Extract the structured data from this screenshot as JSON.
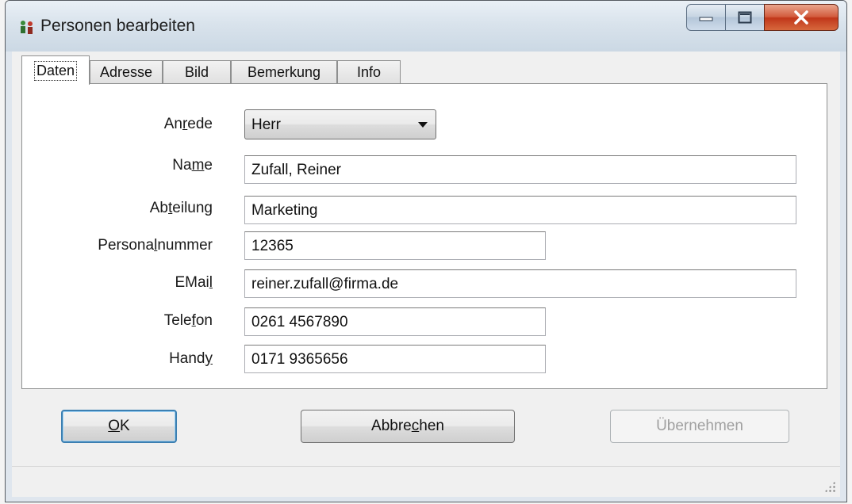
{
  "window": {
    "title": "Personen bearbeiten",
    "icon": "people-icon",
    "controls": {
      "minimize": "minimize-icon",
      "maximize": "maximize-icon",
      "close": "close-icon"
    }
  },
  "tabs": [
    {
      "label": "Daten",
      "active": true
    },
    {
      "label": "Adresse",
      "active": false
    },
    {
      "label": "Bild",
      "active": false
    },
    {
      "label": "Bemerkung",
      "active": false
    },
    {
      "label": "Info",
      "active": false
    }
  ],
  "form": {
    "anrede": {
      "label_pre": "An",
      "label_key": "r",
      "label_post": "ede",
      "value": "Herr",
      "options": [
        "Herr"
      ]
    },
    "name": {
      "label_pre": "Na",
      "label_key": "m",
      "label_post": "e",
      "value": "Zufall, Reiner"
    },
    "abteilung": {
      "label_pre": "Ab",
      "label_key": "t",
      "label_post": "eilung",
      "value": "Marketing"
    },
    "personalnummer": {
      "label_pre": "Persona",
      "label_key": "l",
      "label_post": "nummer",
      "value": "12365"
    },
    "email": {
      "label_pre": "EMai",
      "label_key": "l",
      "label_post": "",
      "value": "reiner.zufall@firma.de"
    },
    "telefon": {
      "label_pre": "Tele",
      "label_key": "f",
      "label_post": "on",
      "value": "0261 4567890"
    },
    "handy": {
      "label_pre": "Hand",
      "label_key": "y",
      "label_post": "",
      "value": "0171 9365656"
    }
  },
  "buttons": {
    "ok": {
      "key": "O",
      "rest": "K"
    },
    "cancel": {
      "pre": "Abbre",
      "key": "c",
      "post": "hen"
    },
    "apply": {
      "label": "Übernehmen",
      "disabled": true
    }
  }
}
